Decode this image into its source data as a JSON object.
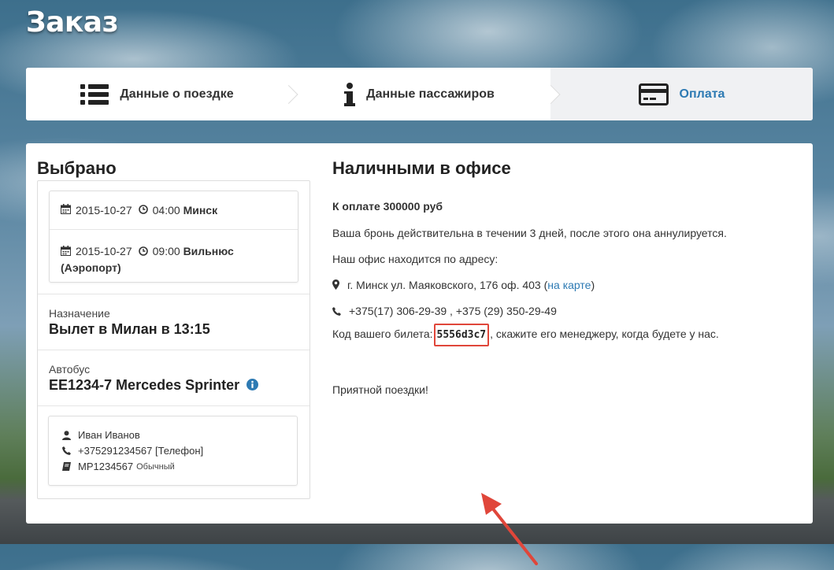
{
  "header": {
    "title": "Заказ"
  },
  "steps": [
    {
      "label": "Данные о поездке",
      "icon": "list-icon"
    },
    {
      "label": "Данные пассажиров",
      "icon": "info-icon"
    },
    {
      "label": "Оплата",
      "icon": "credit-card-icon"
    }
  ],
  "left": {
    "title": "Выбрано",
    "trip": {
      "departure": {
        "date": "2015-10-27",
        "time": "04:00",
        "place": "Минск"
      },
      "arrival": {
        "date": "2015-10-27",
        "time": "09:00",
        "place": "Вильнюс",
        "place_note": "(Аэропорт)"
      }
    },
    "destination": {
      "label": "Назначение",
      "value": "Вылет в Милан в 13:15"
    },
    "bus": {
      "label": "Автобус",
      "value": "EE1234-7 Mercedes Sprinter"
    },
    "passenger": {
      "name": "Иван Иванов",
      "phone": "+375291234567 [Телефон]",
      "document": "MP1234567",
      "document_type": "Обычный"
    }
  },
  "right": {
    "title": "Наличными в офисе",
    "amount": "К оплате 300000 руб",
    "validity": "Ваша бронь действительна в течении 3 дней, после этого она аннулируется.",
    "office_intro": "Наш офис находится по адресу:",
    "address": "г. Минск ул. Маяковского, 176 оф. 403",
    "map_link": "на карте",
    "phones": "+375(17) 306-29-39 , +375 (29) 350-29-49",
    "code_prefix": "Код вашего билета:",
    "code": "5556d3c7",
    "code_suffix": ", скажите его менеджеру, когда будете у нас.",
    "farewell": "Приятной поездки!"
  },
  "colors": {
    "accent": "#2d7ab3",
    "highlight": "#e0463a"
  }
}
